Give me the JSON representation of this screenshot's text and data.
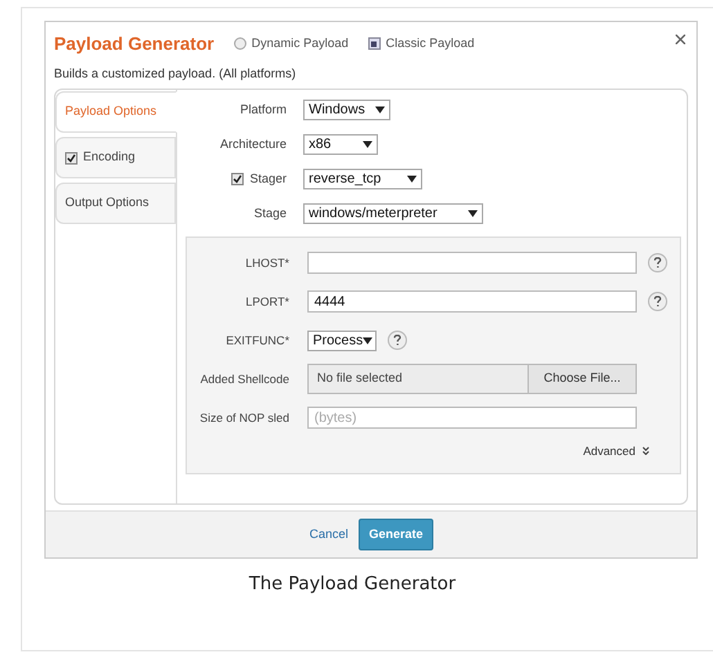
{
  "dialog": {
    "title": "Payload Generator",
    "modes": [
      {
        "label": "Dynamic Payload",
        "selected": false
      },
      {
        "label": "Classic Payload",
        "selected": true
      }
    ],
    "subtitle": "Builds a customized payload. (All platforms)"
  },
  "tabs": [
    {
      "label": "Payload Options",
      "selected": true,
      "kind": "plain"
    },
    {
      "label": "Encoding",
      "selected": false,
      "kind": "checkbox",
      "checked": true
    },
    {
      "label": "Output Options",
      "selected": false,
      "kind": "plain"
    }
  ],
  "options": [
    {
      "label": "Platform",
      "kind": "select",
      "value": "Windows"
    },
    {
      "label": "Architecture",
      "kind": "select",
      "value": "x86"
    },
    {
      "label": "Stager",
      "kind": "checkbox",
      "checked": true,
      "value": "reverse_tcp"
    },
    {
      "label": "Stage",
      "kind": "select",
      "value": "windows/meterpreter"
    }
  ],
  "fields": [
    {
      "label": "LHOST*",
      "kind": "input",
      "help": true
    },
    {
      "label": "LPORT*",
      "kind": "input",
      "value": "4444",
      "help": true
    },
    {
      "label": "EXITFUNC*",
      "kind": "select",
      "value": "Process",
      "help": true
    },
    {
      "label": "Added Shellcode",
      "kind": "file",
      "value": "No file selected",
      "button": "Choose File..."
    },
    {
      "label": "Size of NOP sled",
      "kind": "input",
      "placeholder": "(bytes)",
      "help": false
    }
  ],
  "advanced": "Advanced",
  "buttons": {
    "cancel": "Cancel",
    "generate": "Generate"
  },
  "caption": "The Payload Generator"
}
